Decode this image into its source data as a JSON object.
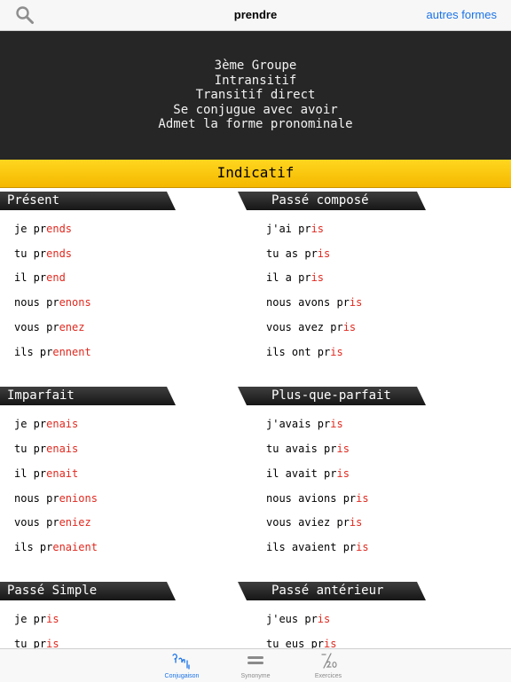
{
  "nav": {
    "title": "prendre",
    "right_label": "autres formes"
  },
  "info": {
    "lines": [
      "3ème Groupe",
      "Intransitif",
      "Transitif direct",
      "Se conjugue avec avoir",
      "Admet la forme pronominale"
    ]
  },
  "mood": "Indicatif",
  "tenses": {
    "present": {
      "title": "Présent",
      "rows": [
        {
          "pre": "je pr",
          "end": "ends"
        },
        {
          "pre": "tu pr",
          "end": "ends"
        },
        {
          "pre": "il pr",
          "end": "end"
        },
        {
          "pre": "nous pr",
          "end": "enons"
        },
        {
          "pre": "vous pr",
          "end": "enez"
        },
        {
          "pre": "ils pr",
          "end": "ennent"
        }
      ]
    },
    "passe_compose": {
      "title": "Passé composé",
      "rows": [
        {
          "pre": "j'ai pr",
          "end": "is"
        },
        {
          "pre": "tu as pr",
          "end": "is"
        },
        {
          "pre": "il a pr",
          "end": "is"
        },
        {
          "pre": "nous avons pr",
          "end": "is"
        },
        {
          "pre": "vous avez pr",
          "end": "is"
        },
        {
          "pre": "ils ont pr",
          "end": "is"
        }
      ]
    },
    "imparfait": {
      "title": "Imparfait",
      "rows": [
        {
          "pre": "je pr",
          "end": "enais"
        },
        {
          "pre": "tu pr",
          "end": "enais"
        },
        {
          "pre": "il pr",
          "end": "enait"
        },
        {
          "pre": "nous pr",
          "end": "enions"
        },
        {
          "pre": "vous pr",
          "end": "eniez"
        },
        {
          "pre": "ils pr",
          "end": "enaient"
        }
      ]
    },
    "plus_que_parfait": {
      "title": "Plus-que-parfait",
      "rows": [
        {
          "pre": "j'avais pr",
          "end": "is"
        },
        {
          "pre": "tu avais pr",
          "end": "is"
        },
        {
          "pre": "il avait pr",
          "end": "is"
        },
        {
          "pre": "nous avions pr",
          "end": "is"
        },
        {
          "pre": "vous aviez pr",
          "end": "is"
        },
        {
          "pre": "ils avaient pr",
          "end": "is"
        }
      ]
    },
    "passe_simple": {
      "title": "Passé Simple",
      "rows": [
        {
          "pre": "je pr",
          "end": "is"
        },
        {
          "pre": "tu pr",
          "end": "is"
        }
      ]
    },
    "passe_anterieur": {
      "title": "Passé antérieur",
      "rows": [
        {
          "pre": "j'eus pr",
          "end": "is"
        },
        {
          "pre": "tu eus pr",
          "end": "is"
        }
      ]
    }
  },
  "tabbar": {
    "tabs": [
      {
        "label": "Conjugaison",
        "icon": "conjugation-icon",
        "active": true
      },
      {
        "label": "Synonyme",
        "icon": "equals-icon",
        "active": false
      },
      {
        "label": "Exercices",
        "icon": "score-icon",
        "active": false
      }
    ]
  },
  "colors": {
    "accent": "#1a73e8",
    "ending": "#e0291f",
    "banner": "#ffd61f",
    "info_bg": "#262626"
  }
}
